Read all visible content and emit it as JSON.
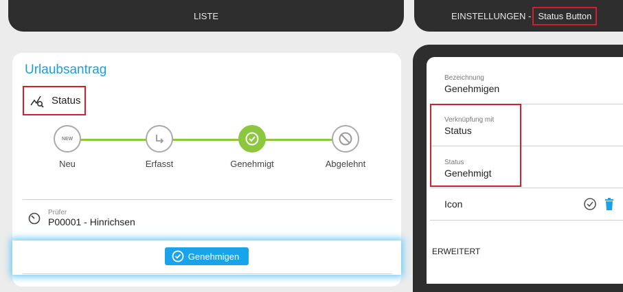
{
  "header": {
    "left_tab": "LISTE",
    "right_tab": "EINSTELLUNGEN",
    "right_tab_separator": " - ",
    "right_tab_highlight": "Status Button"
  },
  "form": {
    "title": "Urlaubsantrag",
    "status_label": "Status",
    "steps": [
      {
        "label": "Neu",
        "badge": "NEW"
      },
      {
        "label": "Erfasst"
      },
      {
        "label": "Genehmigt"
      },
      {
        "label": "Abgelehnt"
      }
    ],
    "pruefer_label": "Prüfer",
    "pruefer_value": "P00001 - Hinrichsen",
    "approve_button": "Genehmigen"
  },
  "settings": {
    "bezeichnung_label": "Bezeichnung",
    "bezeichnung_value": "Genehmigen",
    "verknuepfung_label": "Verknüpfung mit",
    "verknuepfung_value": "Status",
    "status_label": "Status",
    "status_value": "Genehmigt",
    "icon_label": "Icon",
    "erweitert_label": "ERWEITERT"
  },
  "colors": {
    "accent_blue": "#1a9ee0",
    "step_green": "#8dc63f",
    "highlight_red": "#d0202c",
    "dark_bar": "#2e2e2e"
  }
}
